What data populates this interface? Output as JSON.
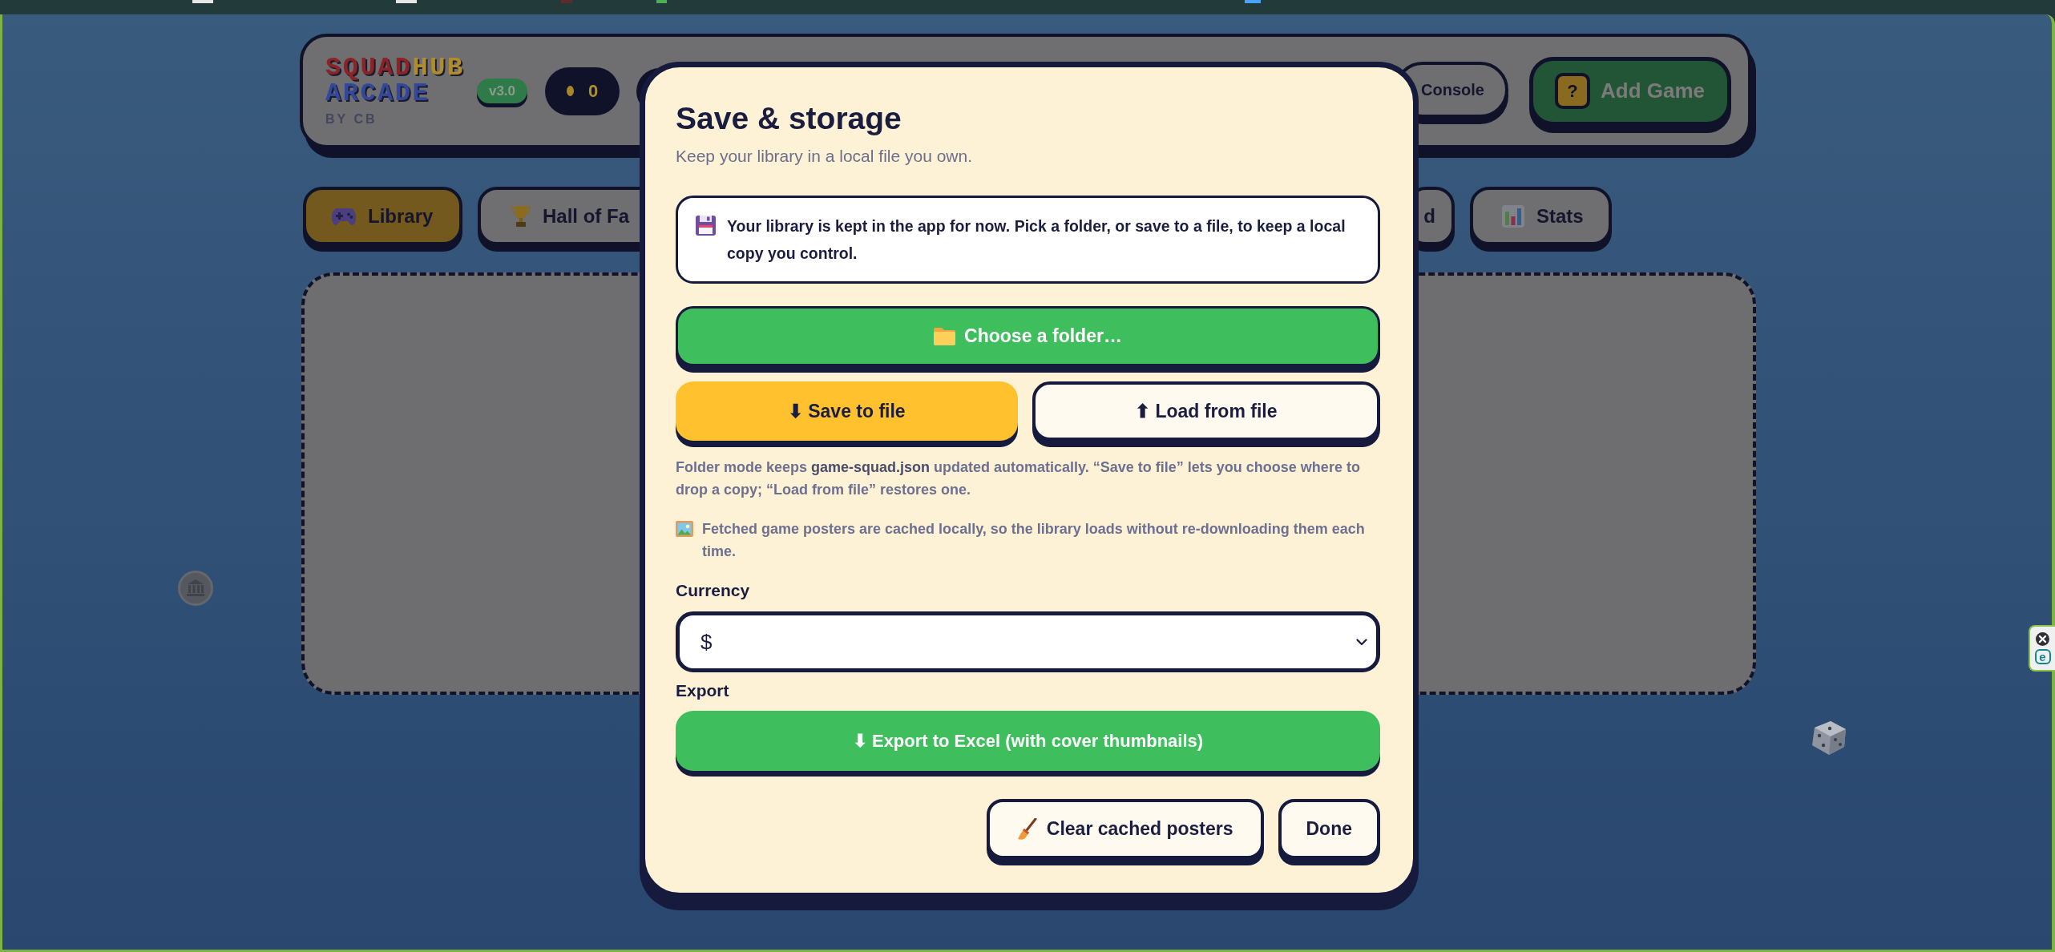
{
  "header": {
    "logo": {
      "title": [
        {
          "text": "SQUAD",
          "color": "#8c2326"
        },
        {
          "text": "HUB",
          "color": "#b08d2c"
        }
      ],
      "subtitle": "ARCADE",
      "byline": "BY CB"
    },
    "version": "v3.0",
    "coins": "0",
    "buttons": [
      {
        "kind": "outline",
        "label": "Console"
      },
      {
        "kind": "primary",
        "badge": "?",
        "label": "Add Game"
      }
    ]
  },
  "tabs": [
    {
      "label": "Library",
      "selected": true
    },
    {
      "label": "Hall of Fa",
      "selected": false
    },
    {
      "label": "d",
      "selected": false
    },
    {
      "label": "Stats",
      "selected": false
    }
  ],
  "side_widget": {
    "logo_letter": "e"
  },
  "dialog": {
    "title": "Save & storage",
    "subtitle": "Keep your library in a local file you own.",
    "notice": "Your library is kept in the app for now. Pick a folder, or save to a file, to keep a local copy you control.",
    "folder_button": "Choose a folder…",
    "file_buttons": [
      {
        "kind": "primary",
        "label": "⬇ Save to file"
      },
      {
        "kind": "secondary",
        "label": "⬆ Load from file"
      }
    ],
    "notes": [
      {
        "kind": "text",
        "text": "Folder mode keeps **game-squad.json** updated automatically. “Save to file” lets you choose where to drop a copy; “Load from file” restores one."
      },
      {
        "kind": "image",
        "text": "Fetched game posters are cached locally, so the library loads without re-downloading them each time."
      }
    ],
    "currency": {
      "label": "Currency",
      "value": "$"
    },
    "export": {
      "label": "Export",
      "button": "⬇ Export to Excel (with cover thumbnails)"
    },
    "footer_buttons": [
      {
        "kind": "clear",
        "label": "Clear cached posters"
      },
      {
        "kind": "plain",
        "label": "Done"
      }
    ]
  }
}
